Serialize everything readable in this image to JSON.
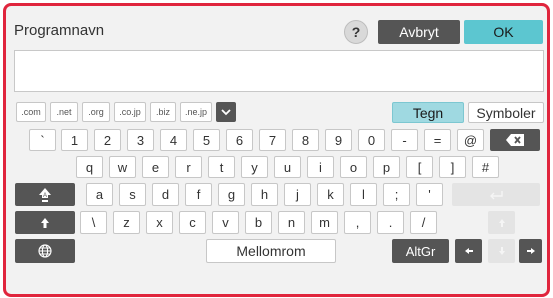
{
  "title": "Programnavn",
  "help_label": "?",
  "cancel_label": "Avbryt",
  "ok_label": "OK",
  "input_value": "",
  "domains": [
    ".com",
    ".net",
    ".org",
    ".co.jp",
    ".biz",
    ".ne.jp"
  ],
  "mode_tabs": {
    "tegn": "Tegn",
    "symboler": "Symboler"
  },
  "row_number": [
    "`",
    "1",
    "2",
    "3",
    "4",
    "5",
    "6",
    "7",
    "8",
    "9",
    "0",
    "-",
    "=",
    "@"
  ],
  "row_top": [
    "q",
    "w",
    "e",
    "r",
    "t",
    "y",
    "u",
    "i",
    "o",
    "p",
    "[",
    "]",
    "#"
  ],
  "row_home": [
    "a",
    "s",
    "d",
    "f",
    "g",
    "h",
    "j",
    "k",
    "l",
    ";",
    "'"
  ],
  "row_bottom": [
    "\\",
    "z",
    "x",
    "c",
    "v",
    "b",
    "n",
    "m",
    ",",
    ".",
    "/"
  ],
  "space_label": "Mellomrom",
  "altgr_label": "AltGr",
  "colors": {
    "frame_border": "#e0253d",
    "accent": "#5cc6d0",
    "tegn_active": "#9fd9e1",
    "dark_key": "#555555"
  }
}
